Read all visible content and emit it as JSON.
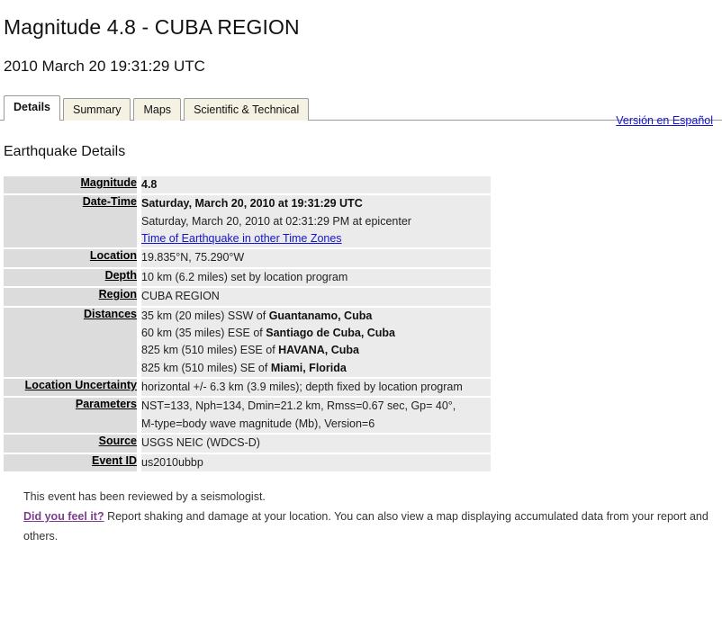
{
  "header": {
    "title": "Magnitude 4.8 - CUBA REGION",
    "subtitle": "2010 March 20 19:31:29 UTC"
  },
  "tabs": [
    {
      "label": "Details",
      "active": true
    },
    {
      "label": "Summary",
      "active": false
    },
    {
      "label": "Maps",
      "active": false
    },
    {
      "label": "Scientific & Technical",
      "active": false
    }
  ],
  "language_link": {
    "label": "Versión en Español"
  },
  "section": {
    "title": "Earthquake Details"
  },
  "details": {
    "magnitude": {
      "label": "Magnitude",
      "value": "4.8"
    },
    "date_time": {
      "label": "Date-Time",
      "line1": "Saturday, March 20, 2010 at 19:31:29 UTC",
      "line2": "Saturday, March 20, 2010 at 02:31:29 PM at epicenter",
      "link": "Time of Earthquake in other Time Zones"
    },
    "location": {
      "label": "Location",
      "value": "19.835°N, 75.290°W"
    },
    "depth": {
      "label": "Depth",
      "value": "10 km (6.2 miles) set by location program"
    },
    "region": {
      "label": "Region",
      "value": "CUBA REGION"
    },
    "distances": {
      "label": "Distances",
      "items": [
        {
          "prefix": "35 km (20 miles) SSW of ",
          "place": "Guantanamo, Cuba"
        },
        {
          "prefix": "60 km (35 miles) ESE of ",
          "place": "Santiago de Cuba, Cuba"
        },
        {
          "prefix": "825 km (510 miles) ESE of ",
          "place": "HAVANA, Cuba"
        },
        {
          "prefix": "825 km (510 miles) SE of ",
          "place": "Miami, Florida"
        }
      ]
    },
    "location_uncertainty": {
      "label": "Location Uncertainty",
      "value": "horizontal +/- 6.3 km (3.9 miles); depth fixed by location program"
    },
    "parameters": {
      "label": "Parameters",
      "line1": "NST=133, Nph=134, Dmin=21.2 km, Rmss=0.67 sec, Gp= 40°,",
      "line2": "M-type=body wave magnitude (Mb), Version=6"
    },
    "source": {
      "label": "Source",
      "value": "USGS NEIC (WDCS-D)"
    },
    "event_id": {
      "label": "Event ID",
      "value": "us2010ubbp"
    }
  },
  "notes": {
    "reviewed": "This event has been reviewed by a seismologist.",
    "dyfi_link": "Did you feel it?",
    "dyfi_text": " Report shaking and damage at your location. You can also view a map displaying accumulated data from your report and others."
  },
  "colors": {
    "link": "#1414cc",
    "visited_link": "#7b3f8c",
    "label_cell_bg": "#dcdcdc",
    "value_cell_bg": "#ebebeb",
    "tab_inactive_bg": "#f5f2e3",
    "tab_border": "#9a9a9a"
  }
}
